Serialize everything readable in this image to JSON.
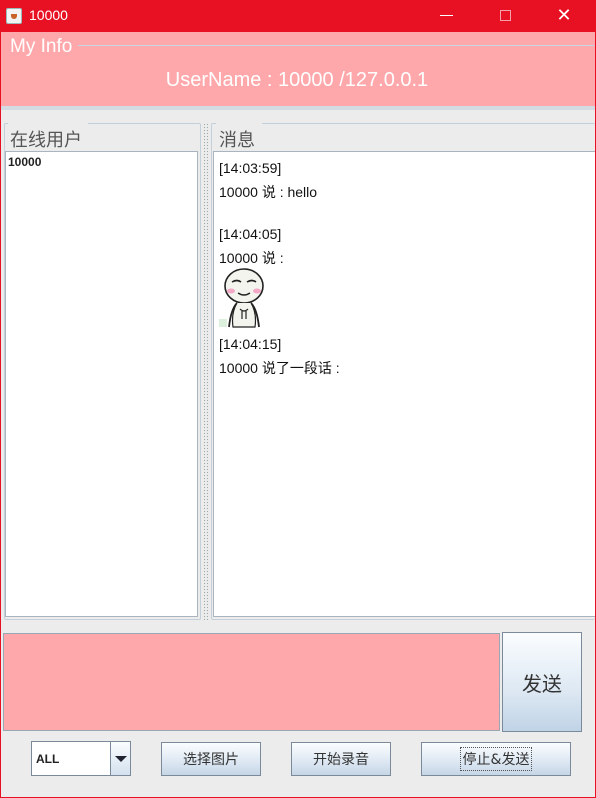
{
  "window": {
    "title": "10000",
    "controls": {
      "minimize": "",
      "maximize": "",
      "close": "✕"
    },
    "accent_color": "#e81123"
  },
  "info": {
    "legend": "My Info",
    "text": "UserName :  10000 /127.0.0.1",
    "background": "#ffa8ab"
  },
  "users": {
    "legend": "在线用户",
    "items": [
      "10000"
    ]
  },
  "messages": {
    "legend": "消息",
    "lines": [
      "[14:03:59]",
      "10000 说 : hello",
      "[14:04:05]",
      "10000 说 :",
      "[14:04:15]",
      "10000 说了一段话 :"
    ]
  },
  "input": {
    "value": "",
    "background": "#ffa8ab"
  },
  "buttons": {
    "send": "发送",
    "choose_image": "选择图片",
    "record": "开始录音",
    "stop_send": "停止&发送"
  },
  "target": {
    "selected": "ALL"
  },
  "icons": [
    "java-app-icon",
    "minimize-icon",
    "maximize-icon",
    "close-icon",
    "dropdown-arrow-icon",
    "emoji-sticker-image"
  ]
}
